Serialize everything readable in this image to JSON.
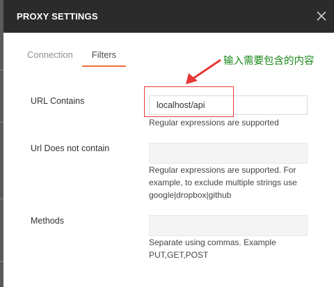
{
  "dialog": {
    "title": "PROXY SETTINGS"
  },
  "tabs": [
    {
      "label": "Connection",
      "active": false
    },
    {
      "label": "Filters",
      "active": true
    }
  ],
  "fields": {
    "url_contains": {
      "label": "URL Contains",
      "value": "localhost/api",
      "helper": "Regular expressions are supported"
    },
    "url_not_contain": {
      "label": "Url Does not contain",
      "value": "",
      "helper_lines": [
        "Regular expressions are supported. For",
        "example, to exclude multiple strings use",
        "google|dropbox|github"
      ]
    },
    "methods": {
      "label": "Methods",
      "value": "",
      "helper_lines": [
        "Separate using commas. Example",
        "PUT,GET,POST"
      ]
    }
  },
  "annotation": {
    "text": "输入需要包含的内容",
    "color": "#1a8a1a",
    "arrow_color": "#e53935"
  },
  "colors": {
    "header_bg": "#2b2b2b",
    "tab_active_underline": "#f26b3a",
    "highlight": "#e53935"
  },
  "icons": {
    "close": "close-icon"
  }
}
